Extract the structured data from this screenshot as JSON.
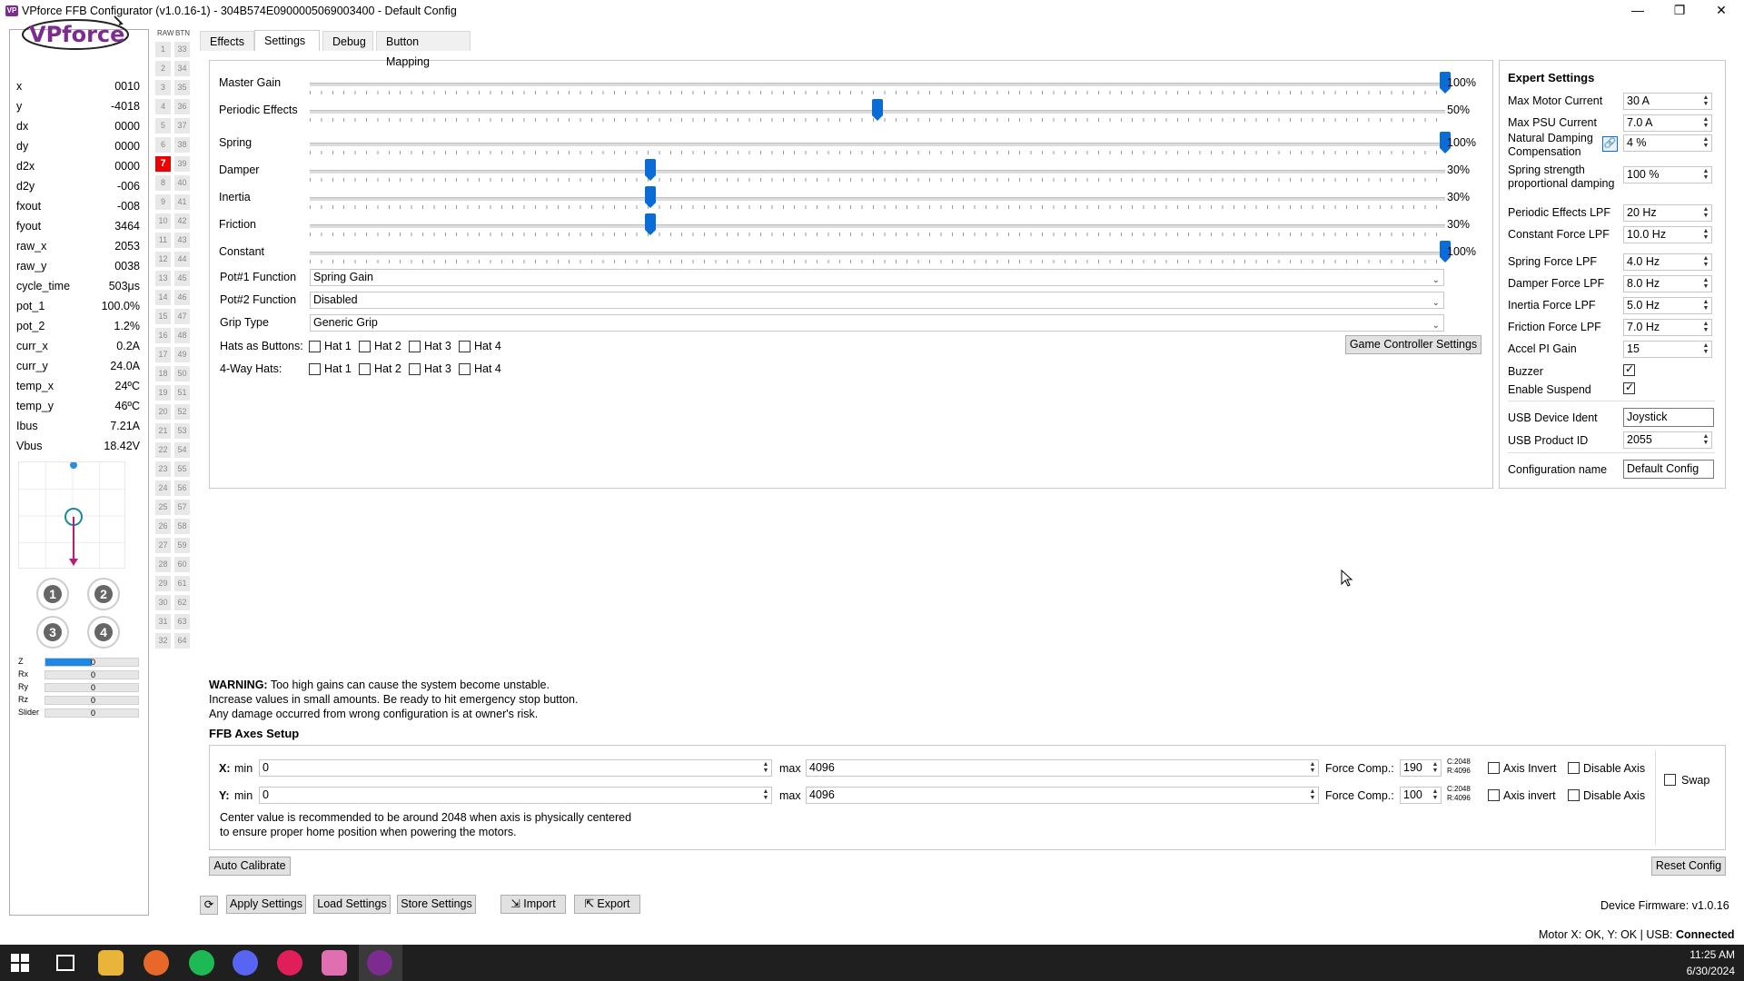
{
  "window": {
    "title": "VPforce FFB Configurator (v1.0.16-1) - 304B574E0900005069003400 - Default Config",
    "icon": "VP",
    "min": "—",
    "max": "❐",
    "close": "✕"
  },
  "tabs": [
    "Effects",
    "Settings",
    "Debug",
    "Button Mapping"
  ],
  "left": {
    "logo_text": "VPforce",
    "stats": [
      {
        "k": "x",
        "v": "0010"
      },
      {
        "k": "y",
        "v": "-4018"
      },
      {
        "k": "dx",
        "v": "0000"
      },
      {
        "k": "dy",
        "v": "0000"
      },
      {
        "k": "d2x",
        "v": "0000"
      },
      {
        "k": "d2y",
        "v": "-006"
      },
      {
        "k": "fxout",
        "v": "-008"
      },
      {
        "k": "fyout",
        "v": "3464"
      },
      {
        "k": "raw_x",
        "v": "2053"
      },
      {
        "k": "raw_y",
        "v": "0038"
      },
      {
        "k": "cycle_time",
        "v": "503μs"
      },
      {
        "k": "pot_1",
        "v": "100.0%"
      },
      {
        "k": "pot_2",
        "v": "1.2%"
      },
      {
        "k": "curr_x",
        "v": "0.2A"
      },
      {
        "k": "curr_y",
        "v": "24.0A"
      },
      {
        "k": "temp_x",
        "v": "24ºC"
      },
      {
        "k": "temp_y",
        "v": "46ºC"
      },
      {
        "k": "Ibus",
        "v": "7.21A"
      },
      {
        "k": "Vbus",
        "v": "18.42V"
      }
    ],
    "hat_buttons": [
      "1",
      "2",
      "3",
      "4"
    ],
    "axes": [
      {
        "name": "Z",
        "value": "0",
        "fill": 0.5
      },
      {
        "name": "Rx",
        "value": "0",
        "fill": 0
      },
      {
        "name": "Ry",
        "value": "0",
        "fill": 0
      },
      {
        "name": "Rz",
        "value": "0",
        "fill": 0
      },
      {
        "name": "Slider",
        "value": "0",
        "fill": 0
      }
    ]
  },
  "buttons_grid": {
    "raw_header": "RAW",
    "btn_header": "BTN",
    "pressed": 7
  },
  "sliders": [
    {
      "label": "Master Gain",
      "value": "100%",
      "level": 1.0
    },
    {
      "label": "Periodic Effects",
      "value": "50%",
      "level": 0.5
    },
    {
      "label": "Spring",
      "value": "100%",
      "level": 1.0
    },
    {
      "label": "Damper",
      "value": "30%",
      "level": 0.3
    },
    {
      "label": "Inertia",
      "value": "30%",
      "level": 0.3
    },
    {
      "label": "Friction",
      "value": "30%",
      "level": 0.3
    },
    {
      "label": "Constant",
      "value": "100%",
      "level": 1.0
    }
  ],
  "combos": [
    {
      "label": "Pot#1 Function",
      "value": "Spring Gain"
    },
    {
      "label": "Pot#2 Function",
      "value": "Disabled"
    },
    {
      "label": "Grip Type",
      "value": "Generic Grip"
    }
  ],
  "hats_as_buttons": {
    "label": "Hats as Buttons:",
    "items": [
      "Hat 1",
      "Hat 2",
      "Hat 3",
      "Hat 4"
    ]
  },
  "four_way_hats": {
    "label": "4-Way Hats:",
    "items": [
      "Hat 1",
      "Hat 2",
      "Hat 3",
      "Hat 4"
    ]
  },
  "game_controller_btn": "Game Controller Settings",
  "expert": {
    "title": "Expert Settings",
    "rows": [
      {
        "label": "Max Motor Current",
        "value": "30 A"
      },
      {
        "label": "Max PSU Current",
        "value": "7.0 A"
      },
      {
        "label": "Natural Damping Compensation",
        "value": "4 %"
      },
      {
        "label": "Spring strength proportional damping",
        "value": "100 %"
      },
      {
        "label": "Periodic Effects LPF",
        "value": "20 Hz"
      },
      {
        "label": "Constant Force LPF",
        "value": "10.0 Hz"
      },
      {
        "label": "Spring Force LPF",
        "value": "4.0 Hz"
      },
      {
        "label": "Damper Force LPF",
        "value": "8.0 Hz"
      },
      {
        "label": "Inertia Force LPF",
        "value": "5.0 Hz"
      },
      {
        "label": "Friction Force LPF",
        "value": "7.0 Hz"
      },
      {
        "label": "Accel PI Gain",
        "value": "15"
      }
    ],
    "buzzer": "Buzzer",
    "enable_suspend": "Enable Suspend",
    "usb_ident_label": "USB Device Ident",
    "usb_ident": "Joystick",
    "usb_pid_label": "USB Product ID",
    "usb_pid": "2055",
    "config_name_label": "Configuration name",
    "config_name": "Default Config"
  },
  "warning": {
    "bold": "WARNING:",
    "l1": " Too high gains can cause the system become unstable.",
    "l2": "Increase values in small amounts. Be ready to hit emergency stop button.",
    "l3": "Any damage occurred from wrong configuration is at owner's risk."
  },
  "ffb": {
    "title": "FFB Axes Setup",
    "x": {
      "label": "X:",
      "min_label": "min",
      "min": "0",
      "max_label": "max",
      "max": "4096",
      "fc_label": "Force Comp.:",
      "fc": "190",
      "c": "C:2048",
      "r": "R:4096",
      "invert": "Axis Invert",
      "disable": "Disable Axis"
    },
    "y": {
      "label": "Y:",
      "min_label": "min",
      "min": "0",
      "max_label": "max",
      "max": "4096",
      "fc_label": "Force Comp.:",
      "fc": "100",
      "c": "C:2048",
      "r": "R:4096",
      "invert": "Axis invert",
      "disable": "Disable Axis"
    },
    "swap": "Swap",
    "note1": "Center value is recommended to be around 2048 when axis is physically centered",
    "note2": "to ensure proper home position when powering the motors."
  },
  "auto_calibrate": "Auto Calibrate",
  "reset_config": "Reset Config",
  "bottom": {
    "refresh": "⟳",
    "apply": "Apply Settings",
    "load": "Load Settings",
    "store": "Store Settings",
    "import": "Import",
    "export": "Export",
    "firmware": "Device Firmware: v1.0.16"
  },
  "status": {
    "prefix": "Motor X: OK, Y: OK | USB: ",
    "state": "Connected"
  },
  "taskbar": {
    "time": "11:25 AM",
    "date": "6/30/2024"
  },
  "colors": {
    "accent": "#0a6cd6",
    "pressed": "#e00000",
    "vpforce": "#7b2c8e",
    "taskbar": "#1f1f1f"
  }
}
